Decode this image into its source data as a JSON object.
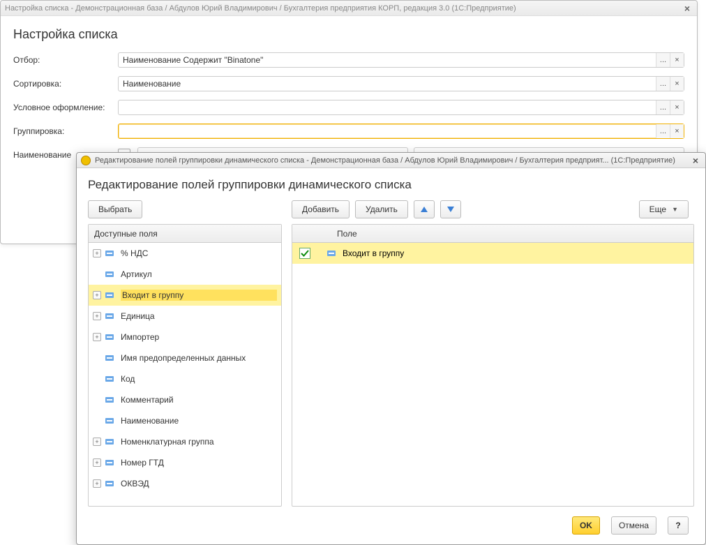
{
  "backWindow": {
    "title": "Настройка списка - Демонстрационная база / Абдулов Юрий Владимирович / Бухгалтерия предприятия КОРП, редакция 3.0  (1С:Предприятие)",
    "heading": "Настройка списка",
    "rows": {
      "filter": {
        "label": "Отбор:",
        "value": "Наименование Содержит \"Binatone\""
      },
      "sort": {
        "label": "Сортировка:",
        "value": "Наименование"
      },
      "cond": {
        "label": "Условное оформление:",
        "value": ""
      },
      "group": {
        "label": "Группировка:",
        "value": ""
      },
      "name": {
        "label": "Наименование"
      }
    },
    "ellipsis": "...",
    "clear": "×"
  },
  "frontWindow": {
    "title": "Редактирование полей группировки динамического списка - Демонстрационная база / Абдулов Юрий Владимирович / Бухгалтерия предприят...  (1С:Предприятие)",
    "heading": "Редактирование полей группировки динамического списка",
    "buttons": {
      "choose": "Выбрать",
      "add": "Добавить",
      "delete": "Удалить",
      "more": "Еще",
      "ok": "OK",
      "cancel": "Отмена",
      "help": "?"
    },
    "leftHeader": "Доступные поля",
    "rightHeader": "Поле",
    "tree": [
      {
        "expand": "+",
        "label": "% НДС"
      },
      {
        "expand": "",
        "label": "Артикул"
      },
      {
        "expand": "+",
        "label": "Входит в группу",
        "hl": true
      },
      {
        "expand": "+",
        "label": "Единица"
      },
      {
        "expand": "+",
        "label": "Импортер"
      },
      {
        "expand": "",
        "label": "Имя предопределенных данных"
      },
      {
        "expand": "",
        "label": "Код"
      },
      {
        "expand": "",
        "label": "Комментарий"
      },
      {
        "expand": "",
        "label": "Наименование"
      },
      {
        "expand": "+",
        "label": "Номенклатурная группа"
      },
      {
        "expand": "+",
        "label": "Номер ГТД"
      },
      {
        "expand": "+",
        "label": "ОКВЭД"
      }
    ],
    "selectedField": "Входит в группу"
  }
}
